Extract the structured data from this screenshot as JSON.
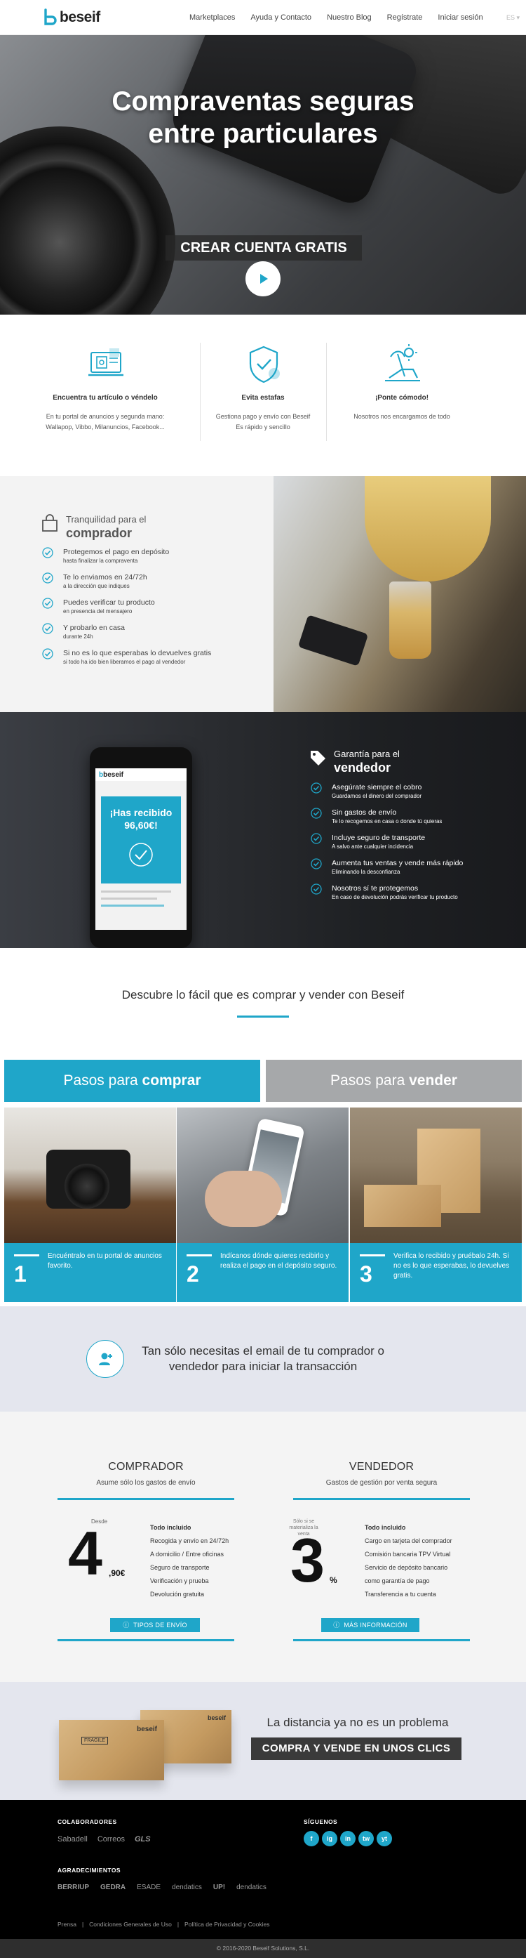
{
  "brand": {
    "name": "beseif",
    "accent": "#1fa6c9"
  },
  "nav": {
    "items": [
      "Marketplaces",
      "Ayuda y Contacto",
      "Nuestro Blog",
      "Regístrate",
      "Iniciar sesión"
    ],
    "lang": "ES ▾"
  },
  "hero": {
    "title_line1": "Compraventas seguras",
    "title_line2": "entre particulares",
    "cta": "CREAR CUENTA GRATIS"
  },
  "features": [
    {
      "title": "Encuentra tu artículo o véndelo",
      "desc1": "En tu portal de anuncios y segunda mano:",
      "desc2": "Wallapop, Vibbo, Milanuncios, Facebook...",
      "icon": "laptop-shop-icon"
    },
    {
      "title": "Evita estafas",
      "desc1": "Gestiona pago y envío con Beseif",
      "desc2": "Es rápido y sencillo",
      "icon": "shield-icon"
    },
    {
      "title": "¡Ponte cómodo!",
      "desc1": "Nosotros nos encargamos de todo",
      "desc2": "",
      "icon": "beach-chair-icon"
    }
  ],
  "buyer": {
    "title1": "Tranquilidad para el",
    "title2": "comprador",
    "items": [
      {
        "main": "Protegemos el pago en depósito",
        "sub": "hasta finalizar la compraventa"
      },
      {
        "main": "Te lo enviamos en 24/72h",
        "sub": "a la dirección que indiques"
      },
      {
        "main": "Puedes verificar tu producto",
        "sub": "en presencia del mensajero"
      },
      {
        "main": "Y probarlo en casa",
        "sub": "durante 24h"
      },
      {
        "main": "Si no es lo que esperabas lo devuelves gratis",
        "sub": "si todo ha ido bien liberamos el pago al vendedor"
      }
    ]
  },
  "seller": {
    "title1": "Garantía para el",
    "title2": "vendedor",
    "items": [
      {
        "main": "Asegúrate siempre el cobro",
        "sub": "Guardamos el dinero del comprador"
      },
      {
        "main": "Sin gastos de envío",
        "sub": "Te lo recogemos en casa o donde tú quieras"
      },
      {
        "main": "Incluye seguro de transporte",
        "sub": "A salvo ante cualquier incidencia"
      },
      {
        "main": "Aumenta tus ventas y vende más rápido",
        "sub": "Eliminando la desconfianza"
      },
      {
        "main": "Nosotros sí te protegemos",
        "sub": "En caso de devolución podrás verificar tu producto"
      }
    ],
    "phone_msg1": "¡Has recibido",
    "phone_msg2": "96,60€!"
  },
  "discover": {
    "title": "Descubre lo fácil que es comprar y vender con Beseif",
    "tab_buy_pre": "Pasos para ",
    "tab_buy_bold": "comprar",
    "tab_sell_pre": "Pasos para ",
    "tab_sell_bold": "vender",
    "steps": [
      {
        "num": "1",
        "text": "Encuéntralo en tu portal de anuncios favorito."
      },
      {
        "num": "2",
        "text": "Indícanos dónde quieres recibirlo y realiza el pago en el depósito seguro."
      },
      {
        "num": "3",
        "text": "Verifica lo recibido y pruébalo 24h. Si no es lo que esperabas, lo devuelves gratis."
      }
    ]
  },
  "email_banner": {
    "line1": "Tan sólo necesitas el email de tu comprador o",
    "line2": "vendedor para iniciar la transacción"
  },
  "pricing": {
    "buyer": {
      "title": "COMPRADOR",
      "subtitle": "Asume sólo los gastos de envío",
      "desde": "Desde",
      "big": "4",
      "small": ",90€",
      "list_title": "Todo incluido",
      "list": [
        "Recogida y envío en 24/72h",
        "A domicilio / Entre oficinas",
        "Seguro de transporte",
        "Verificación y prueba",
        "Devolución gratuita"
      ],
      "button": "TIPOS DE ENVÍO"
    },
    "seller": {
      "title": "VENDEDOR",
      "subtitle": "Gastos de gestión por venta segura",
      "note": "Sólo si se materializa la venta",
      "big": "3",
      "small": "%",
      "list_title": "Todo incluido",
      "list": [
        "Cargo en tarjeta del comprador",
        "Comisión bancaria TPV Virtual",
        "Servicio de depósito bancario",
        "como garantía de pago",
        "Transferencia a tu cuenta"
      ],
      "button": "MÁS INFORMACIÓN"
    }
  },
  "distance": {
    "title": "La distancia ya no es un problema",
    "cta": "COMPRA Y VENDE EN UNOS CLICS",
    "box_label": "beseif",
    "fragile": "FRAGILE"
  },
  "footer": {
    "collab_title": "COLABORADORES",
    "collab": [
      "Sabadell",
      "Correos",
      "GLS"
    ],
    "follow_title": "SÍGUENOS",
    "social": [
      "f",
      "ig",
      "in",
      "tw",
      "yt"
    ],
    "thanks_title": "AGRADECIMIENTOS",
    "thanks": [
      "BERRIUP",
      "GEDRA",
      "ESADE",
      "dendatics",
      "UP!",
      "dendatics"
    ],
    "links": [
      "Prensa",
      "|",
      "Condiciones Generales de Uso",
      "|",
      "Política de Privacidad y Cookies"
    ],
    "copyright": "© 2016-2020 Beseif Solutions, S.L."
  }
}
